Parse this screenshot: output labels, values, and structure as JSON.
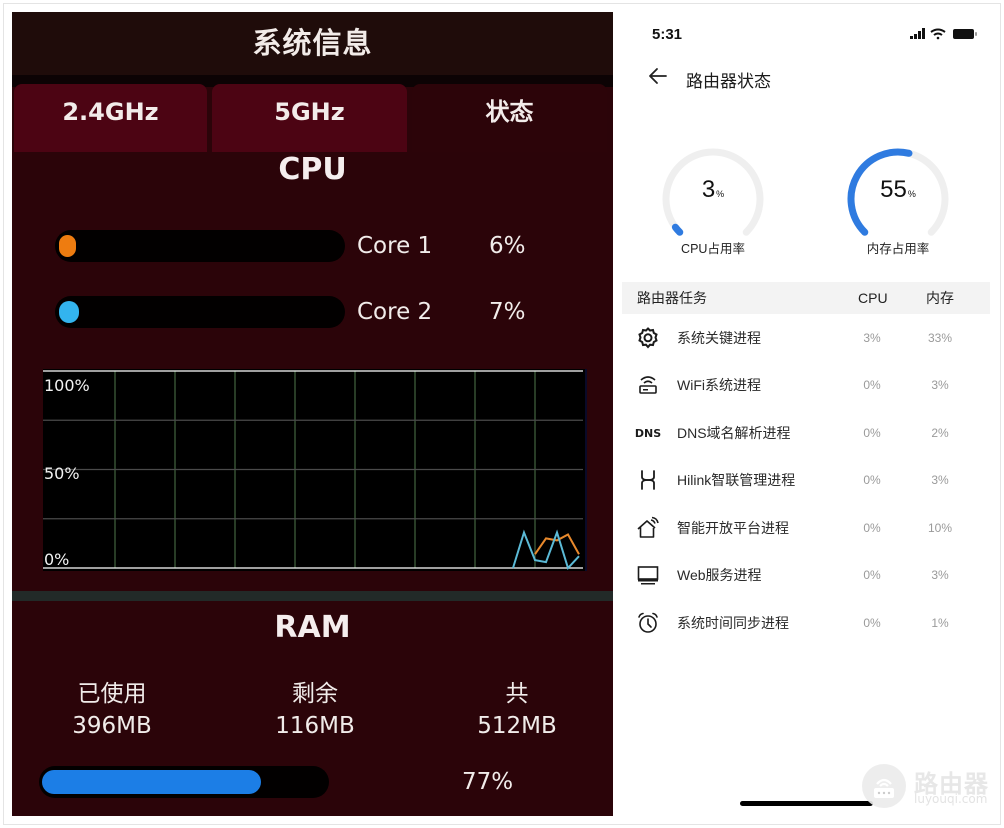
{
  "left": {
    "header_title": "系统信息",
    "tabs": [
      {
        "label": "2.4GHz",
        "active": false
      },
      {
        "label": "5GHz",
        "active": false
      },
      {
        "label": "状态",
        "active": true
      }
    ],
    "cpu": {
      "title": "CPU",
      "cores": [
        {
          "label": "Core 1",
          "value_text": "6%",
          "percent": 6,
          "color": "#ee7c10"
        },
        {
          "label": "Core 2",
          "value_text": "7%",
          "percent": 7,
          "color": "#33b4ee"
        }
      ]
    },
    "ram": {
      "title": "RAM",
      "columns": [
        {
          "label": "已使用",
          "value": "396MB"
        },
        {
          "label": "剩余",
          "value": "116MB"
        },
        {
          "label": "共",
          "value": "512MB"
        }
      ],
      "percent": 77,
      "percent_text": "77%",
      "bar_color": "#1c7ee6"
    }
  },
  "chart_data": {
    "type": "line",
    "title": "",
    "xlabel": "",
    "ylabel": "",
    "ylim": [
      0,
      100
    ],
    "y_tick_labels": [
      "100%",
      "50%",
      "0%"
    ],
    "grid": true,
    "x_points": 27,
    "series": [
      {
        "name": "Core 1",
        "color": "#e8892c",
        "values": [
          null,
          null,
          null,
          null,
          null,
          null,
          null,
          null,
          null,
          null,
          null,
          null,
          null,
          null,
          null,
          null,
          null,
          null,
          null,
          null,
          null,
          null,
          null,
          null,
          7,
          15,
          14,
          17,
          7
        ]
      },
      {
        "name": "Core 2",
        "color": "#5bbad6",
        "values": [
          null,
          null,
          null,
          null,
          null,
          null,
          null,
          null,
          null,
          null,
          null,
          null,
          null,
          null,
          null,
          null,
          null,
          null,
          null,
          null,
          null,
          null,
          0,
          18,
          4,
          3,
          18,
          0,
          6
        ]
      }
    ]
  },
  "right": {
    "status_bar": {
      "time": "5:31"
    },
    "nav": {
      "title": "路由器状态"
    },
    "gauges": [
      {
        "value": 3,
        "unit": "%",
        "label": "CPU占用率"
      },
      {
        "value": 55,
        "unit": "%",
        "label": "内存占用率"
      }
    ],
    "gauge_color": "#2f7be0",
    "table": {
      "headers": {
        "name": "路由器任务",
        "cpu": "CPU",
        "mem": "内存"
      },
      "rows": [
        {
          "icon": "gear-icon",
          "name": "系统关键进程",
          "cpu": "3%",
          "mem": "33%"
        },
        {
          "icon": "wifi-router-icon",
          "name": "WiFi系统进程",
          "cpu": "0%",
          "mem": "3%"
        },
        {
          "icon": "dns-icon",
          "icon_text": "DNS",
          "name": "DNS域名解析进程",
          "cpu": "0%",
          "mem": "2%"
        },
        {
          "icon": "hilink-icon",
          "name": "Hilink智联管理进程",
          "cpu": "0%",
          "mem": "3%"
        },
        {
          "icon": "smart-home-icon",
          "name": "智能开放平台进程",
          "cpu": "0%",
          "mem": "10%"
        },
        {
          "icon": "monitor-icon",
          "name": "Web服务进程",
          "cpu": "0%",
          "mem": "3%"
        },
        {
          "icon": "alarm-clock-icon",
          "name": "系统时间同步进程",
          "cpu": "0%",
          "mem": "1%"
        }
      ]
    }
  },
  "watermark": {
    "text": "路由器",
    "url": "luyouqi.com"
  }
}
